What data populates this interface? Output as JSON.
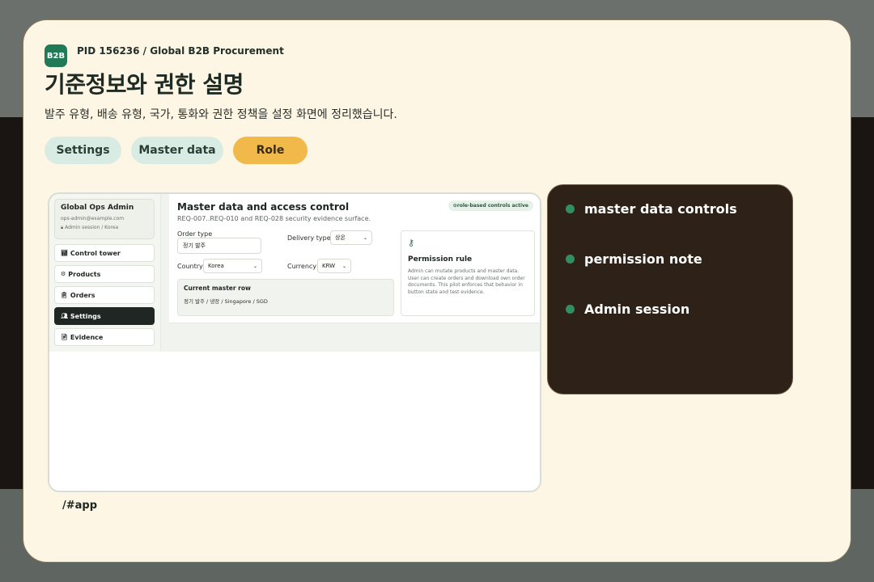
{
  "header": {
    "logo_text": "B2B",
    "pid": "PID 156236 / Global B2B Procurement",
    "title": "기준정보와 권한 설명",
    "subtitle": "발주 유형, 배송 유형, 국가, 통화와 권한 정책을 설정 화면에 정리했습니다."
  },
  "chips": [
    {
      "label": "Settings"
    },
    {
      "label": "Master data"
    },
    {
      "label": "Role"
    }
  ],
  "app": {
    "profile": {
      "name": "Global Ops Admin",
      "email": "ops-admin@example.com",
      "session": "Admin session / Korea"
    },
    "nav": [
      {
        "label": "Control tower",
        "icon": "chart-icon"
      },
      {
        "label": "Products",
        "icon": "boxes-icon"
      },
      {
        "label": "Orders",
        "icon": "clipboard-icon"
      },
      {
        "label": "Settings",
        "icon": "users-gear-icon",
        "active": true
      },
      {
        "label": "Evidence",
        "icon": "document-icon"
      }
    ],
    "panel": {
      "title": "Master data and access control",
      "subtitle": "REQ-007..REQ-010 and REQ-028 security evidence surface.",
      "badge": "⊙role-based controls active",
      "order_type_label": "Order type",
      "order_type_value": "정기 발주",
      "delivery_type_label": "Delivery type",
      "delivery_type_value": "상온",
      "country_label": "Country",
      "country_value": "Korea",
      "currency_label": "Currency",
      "currency_value": "KRW",
      "current_row_title": "Current master row",
      "current_row_value": "정기 발주 / 냉장 / Singapore / SGD",
      "permission_title": "Permission rule",
      "permission_desc": "Admin can mutate products and master data. User can create orders and download own order documents. This pilot enforces that behavior in button state and test evidence."
    }
  },
  "path": "/#app",
  "notes": [
    {
      "label": "master data controls"
    },
    {
      "label": "permission note"
    },
    {
      "label": "Admin session"
    }
  ],
  "colors": {
    "accent_green": "#1f7a55",
    "role_chip": "#f0b94a",
    "chip_bg": "#d8ece3",
    "notes_bg": "#2e2218"
  }
}
